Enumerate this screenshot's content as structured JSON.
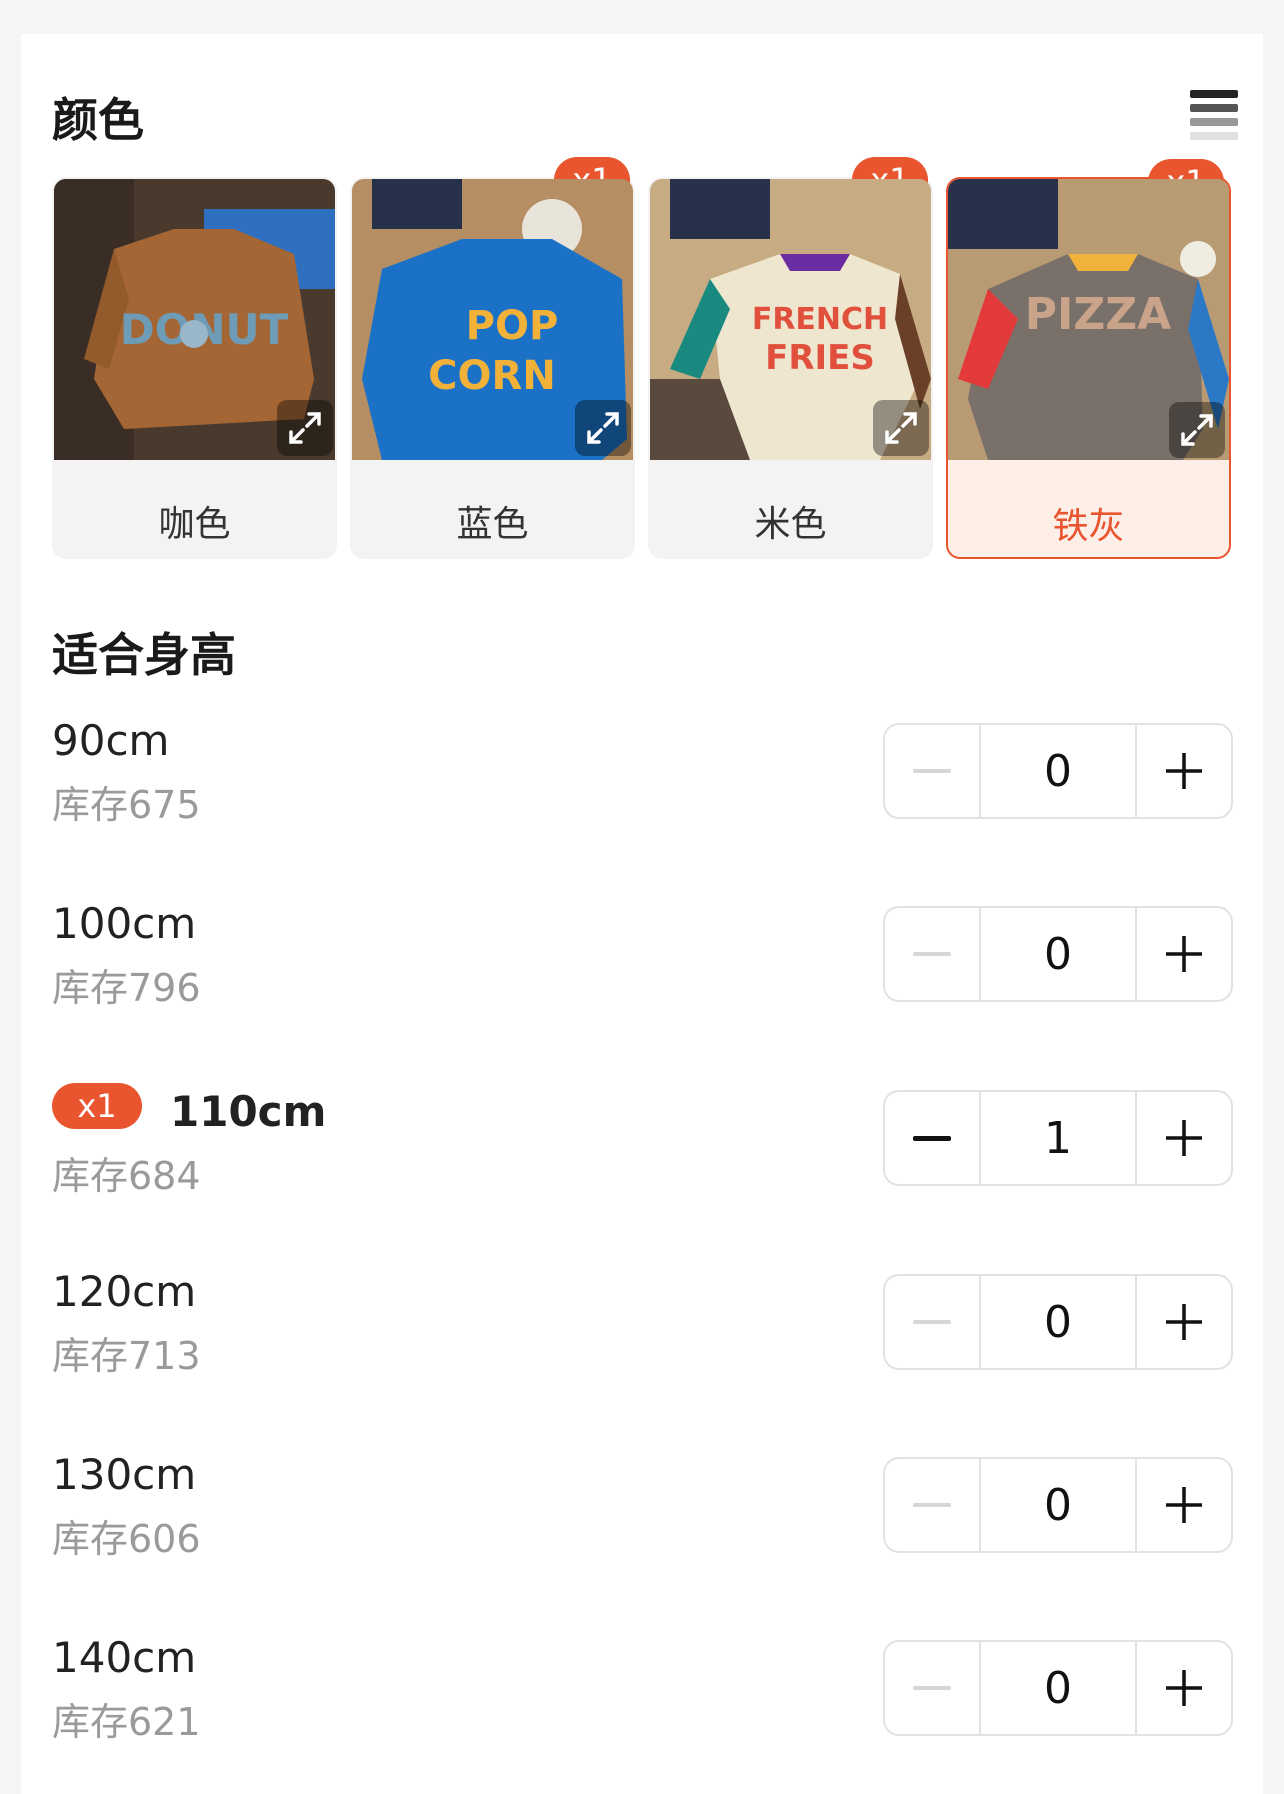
{
  "color_section": {
    "title": "颜色",
    "options": [
      {
        "name": "咖色",
        "badge": "",
        "selected": false,
        "icon": "expand-icon"
      },
      {
        "name": "蓝色",
        "badge": "x1",
        "selected": false,
        "icon": "expand-icon"
      },
      {
        "name": "米色",
        "badge": "x1",
        "selected": false,
        "icon": "expand-icon"
      },
      {
        "name": "铁灰",
        "badge": "x1",
        "selected": true,
        "icon": "expand-icon"
      }
    ]
  },
  "size_section": {
    "title": "适合身高",
    "rows": [
      {
        "size": "90cm",
        "stock": "库存675",
        "qty": "0",
        "badge": ""
      },
      {
        "size": "100cm",
        "stock": "库存796",
        "qty": "0",
        "badge": ""
      },
      {
        "size": "110cm",
        "stock": "库存684",
        "qty": "1",
        "badge": "x1"
      },
      {
        "size": "120cm",
        "stock": "库存713",
        "qty": "0",
        "badge": ""
      },
      {
        "size": "130cm",
        "stock": "库存606",
        "qty": "0",
        "badge": ""
      },
      {
        "size": "140cm",
        "stock": "库存621",
        "qty": "0",
        "badge": ""
      }
    ]
  },
  "accent_color": "#e8552f"
}
